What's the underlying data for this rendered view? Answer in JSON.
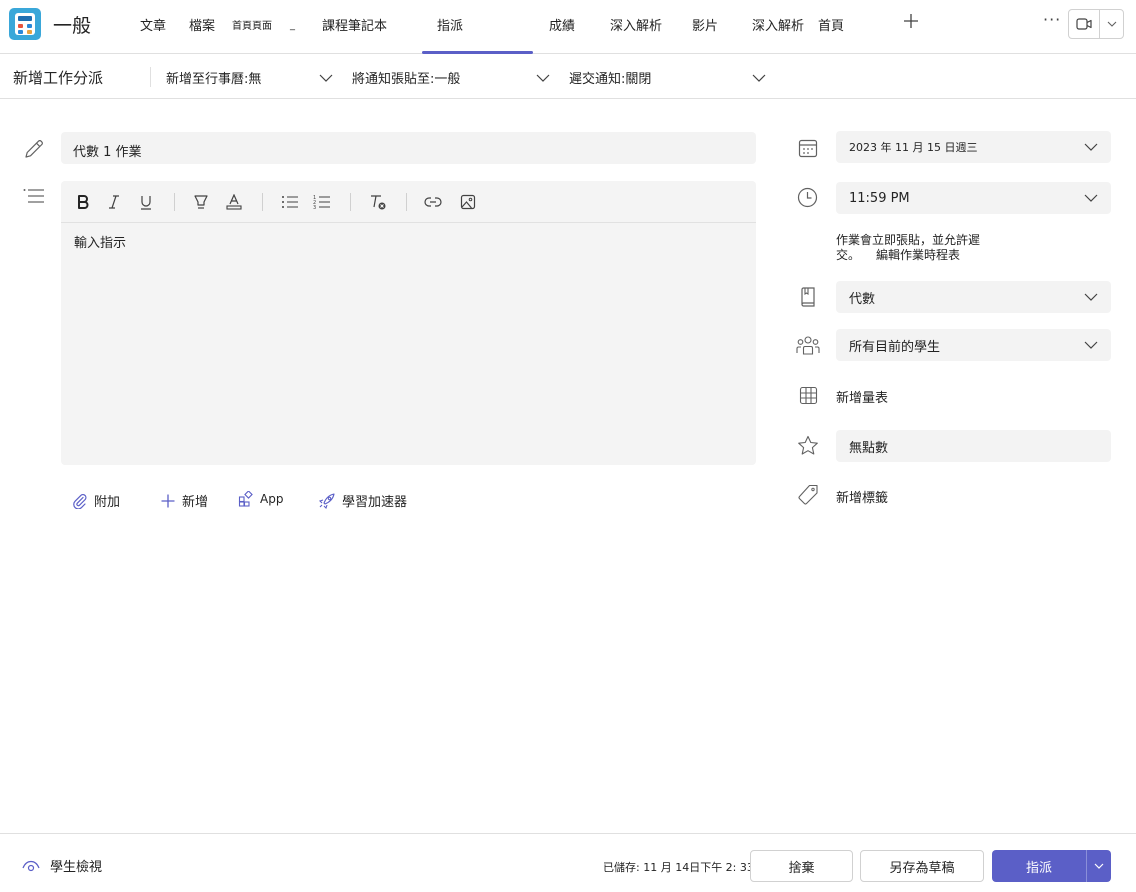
{
  "topbar": {
    "channel_title": "一般",
    "tabs": [
      {
        "label": "文章"
      },
      {
        "label": "檔案"
      },
      {
        "label": "首頁頁面"
      },
      {
        "label": "_"
      },
      {
        "label": "課程筆記本"
      },
      {
        "label": "指派"
      },
      {
        "label": "成績"
      },
      {
        "label": "深入解析"
      },
      {
        "label": "影片"
      },
      {
        "label": "深入解析"
      },
      {
        "label": "首頁"
      }
    ],
    "active_tab": "指派",
    "add_tab_icon": "plus-icon",
    "more_icon": "more-icon",
    "meet_icon": "video-camera-icon"
  },
  "subbar": {
    "title": "新增工作分派",
    "add_to_calendar": "新增至行事曆:無",
    "post_to": "將通知張貼至:一般",
    "submission_notice": "遲交通知:關閉"
  },
  "form": {
    "title_value": "代數 1 作業",
    "instructions_placeholder": "輸入指示",
    "toolbar": [
      "bold-icon",
      "italic-icon",
      "underline-icon",
      "highlight-icon",
      "font-color-icon",
      "bullet-list-icon",
      "numbered-list-icon",
      "clear-format-icon",
      "link-icon",
      "image-icon"
    ],
    "actions": {
      "attach": "附加",
      "new": "新增",
      "app": "App",
      "learning_accelerators": "學習加速器"
    }
  },
  "settings": {
    "due_date": "2023 年 11 月 15 日週三",
    "due_time": "11:59 PM",
    "schedule_note": "作業會立即張貼，並允許遲交。",
    "edit_schedule": "編輯作業時程表",
    "category": "代數",
    "assign_to": "所有目前的學生",
    "add_rubric": "新增量表",
    "points": "無點數",
    "add_tag": "新增標籤"
  },
  "footer": {
    "student_view": "學生檢視",
    "saved_status": "已儲存: 11 月 14日下午 2: 33",
    "discard": "捨棄",
    "save_draft": "另存為草稿",
    "assign": "指派"
  },
  "colors": {
    "accent": "#5b5fc7",
    "field_bg": "#f3f3f3",
    "app_icon": "#3aa7d9"
  }
}
